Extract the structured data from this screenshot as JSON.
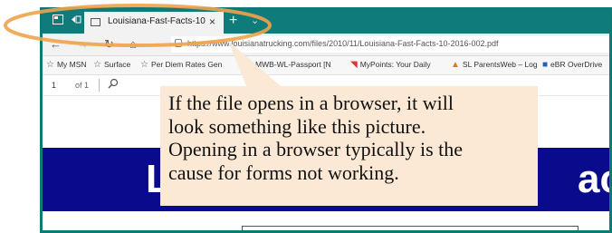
{
  "browser": {
    "tab_title": "Louisiana-Fast-Facts-10",
    "tab_close": "×",
    "new_tab": "+",
    "url": "https://www.louisianatrucking.com/files/2010/11/Louisiana-Fast-Facts-10-2016-002.pdf",
    "icons": {
      "tab_actions": "tab-actions-icon",
      "back_tabs": "set-aside-tabs-icon",
      "back": "back-arrow-icon",
      "forward": "forward-arrow-icon",
      "refresh": "refresh-icon",
      "home": "home-icon",
      "lock": "lock-icon"
    },
    "accent_color": "#0f7b7a"
  },
  "favorites": [
    {
      "label": "My MSN",
      "icon": "☆"
    },
    {
      "label": "Surface",
      "icon": "☆"
    },
    {
      "label": "Per Diem Rates Gen",
      "icon": "☆"
    },
    {
      "label": "MWB-WL-Passport [N",
      "icon": "▬"
    },
    {
      "label": "MyPoints: Your Daily",
      "icon": "◥"
    },
    {
      "label": "SL ParentsWeb – Log",
      "icon": "▲"
    },
    {
      "label": "eBR OverDrive",
      "icon": "■"
    }
  ],
  "pdf_toolbar": {
    "page_number": "1",
    "page_of": "of 1",
    "search_icon": "search-icon"
  },
  "document": {
    "banner_left_text": "L",
    "banner_right_text": "ac",
    "banner_color": "#0a0a8c"
  },
  "callout": {
    "lines": [
      "If the file opens in a browser, it will",
      "look something like this picture.",
      "Opening in a browser typically is the",
      "cause for forms not working."
    ],
    "background": "#fbe9d5"
  },
  "highlight": {
    "color": "#f0a24a"
  }
}
